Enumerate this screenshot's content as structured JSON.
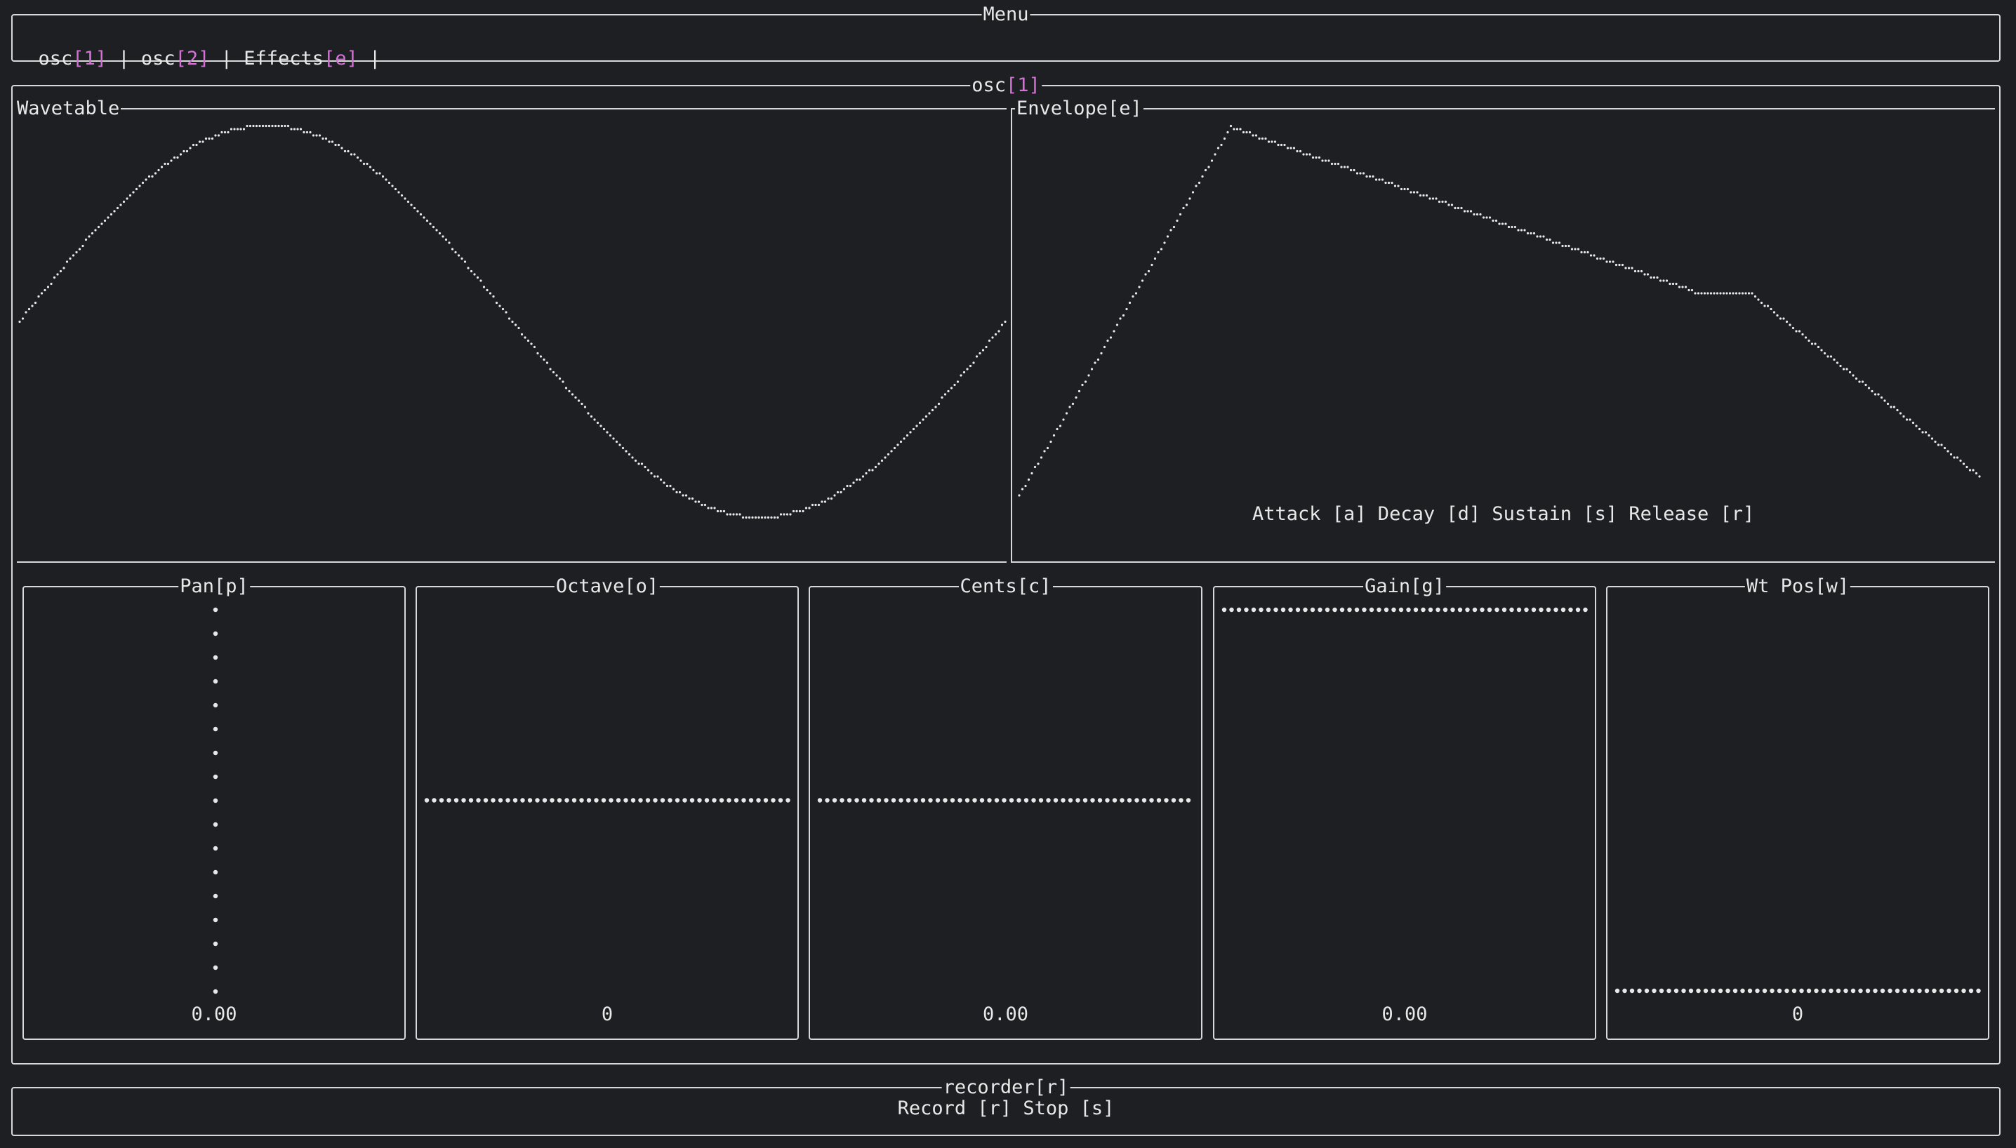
{
  "menu": {
    "title": "Menu",
    "items": [
      {
        "label": "osc",
        "key": "[1]"
      },
      {
        "label": "osc",
        "key": "[2]"
      },
      {
        "label": "Effects",
        "key": "[e]"
      }
    ],
    "separator": " | "
  },
  "osc": {
    "title": "osc",
    "key": "[1]",
    "wavetable": {
      "title": "Wavetable",
      "shape": "sine",
      "cycles": 1
    },
    "envelope": {
      "title": "Envelope[e]",
      "attack": 0.22,
      "decay_end": 0.76,
      "peak": 1.0,
      "sustain_level": 0.55,
      "release_end": 0.05,
      "help": "Attack [a] Decay [d] Sustain [s] Release [r]"
    },
    "knobs": [
      {
        "title": "Pan[p]",
        "value": "0.00",
        "orientation": "vertical",
        "level": 0.5
      },
      {
        "title": "Octave[o]",
        "value": "0",
        "orientation": "horizontal",
        "level": 0.5
      },
      {
        "title": "Cents[c]",
        "value": "0.00",
        "orientation": "horizontal",
        "level": 0.5
      },
      {
        "title": "Gain[g]",
        "value": "0.00",
        "orientation": "horizontal",
        "level": 1.0
      },
      {
        "title": "Wt Pos[w]",
        "value": "0",
        "orientation": "horizontal",
        "level": 0.0
      }
    ]
  },
  "recorder": {
    "title": "recorder[r]",
    "help": "Record [r] Stop [s]"
  },
  "colors": {
    "background": "#1e1f22",
    "foreground": "#e8e8e8",
    "accent": "#d570d6",
    "border": "#d8d8d8"
  }
}
